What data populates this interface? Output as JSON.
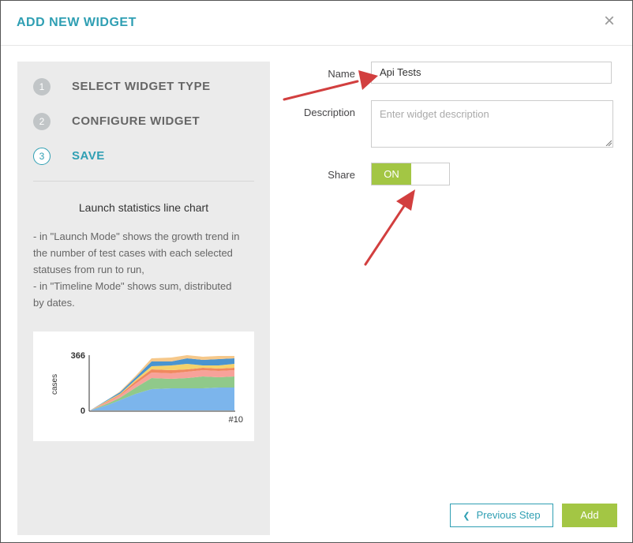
{
  "dialog": {
    "title": "ADD NEW WIDGET",
    "close_glyph": "×"
  },
  "steps": [
    {
      "number": "1",
      "label": "SELECT WIDGET TYPE"
    },
    {
      "number": "2",
      "label": "CONFIGURE WIDGET"
    },
    {
      "number": "3",
      "label": "SAVE"
    }
  ],
  "widget_info": {
    "title": "Launch statistics line chart",
    "description_lines": [
      "- in \"Launch Mode\" shows the growth trend in",
      "the number of test cases with each selected",
      "statuses from run to run,",
      "- in \"Timeline Mode\" shows sum, distributed",
      "by dates."
    ]
  },
  "preview_chart": {
    "ymax_label": "366",
    "ymin_label": "0",
    "ylabel": "cases",
    "xlabel": "#10"
  },
  "form": {
    "name_label": "Name",
    "name_value": "Api Tests",
    "description_label": "Description",
    "description_placeholder": "Enter widget description",
    "share_label": "Share",
    "share_state": "ON"
  },
  "footer": {
    "prev_label": "Previous Step",
    "prev_icon": "chevron-left-icon",
    "add_label": "Add"
  },
  "colors": {
    "accent": "#2f9fb3",
    "green": "#a3c644",
    "arrow": "#d23f3f"
  },
  "annotations": {
    "arrows": [
      "arrow-to-name-field",
      "arrow-to-share-toggle"
    ]
  }
}
